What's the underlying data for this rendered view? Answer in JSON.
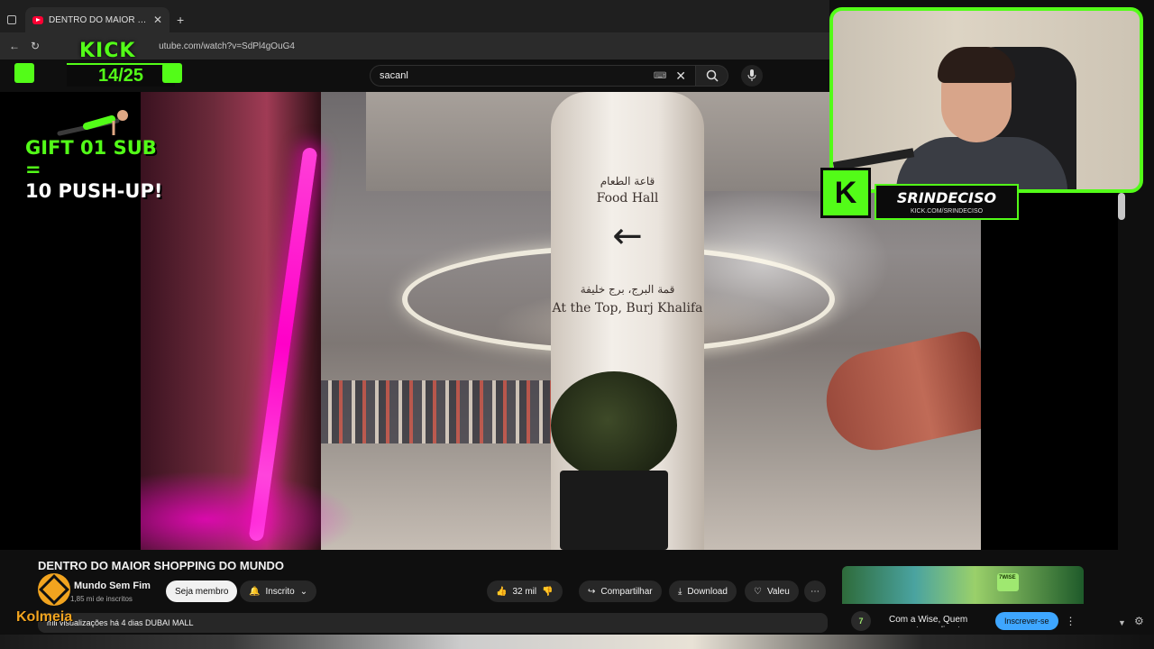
{
  "browser": {
    "tab_title": "DENTRO DO MAIOR SHOPPI",
    "url": "utube.com/watch?v=SdPl4gOuG4"
  },
  "search": {
    "query": "sacanl"
  },
  "overlay": {
    "kick_logo": "KICK",
    "counter": "14/25",
    "gift_line1": "GIFT 01 SUB =",
    "gift_line2": "10 PUSH-UP!",
    "streamer_name": "SRINDECISO",
    "streamer_url": "KICK.COM/SRINDECISO",
    "kolmeia": "Kolmeia"
  },
  "video_sign": {
    "ar1": "قاعة الطعام",
    "en1": "Food Hall",
    "arrow": "←",
    "ar2": "قمة البرج، برج خليفة",
    "en2": "At the Top, Burj Khalifa"
  },
  "video": {
    "title": "DENTRO DO MAIOR SHOPPING DO MUNDO",
    "channel_name": "Mundo Sem Fim",
    "channel_subs": "1,85 mi de inscritos",
    "join_label": "Seja membro",
    "subscribed_label": "Inscrito",
    "likes": "32 mil",
    "share_label": "Compartilhar",
    "download_label": "Download",
    "thanks_label": "Valeu",
    "description": "mil visualizações  há 4 dias  DUBAI MALL"
  },
  "ad": {
    "logo_text": "7WISE",
    "icon_text": "7",
    "text": "Com a Wise, Quem converte se diverte",
    "cta": "Inscrever-se"
  },
  "colors": {
    "kick_green": "#53fc18",
    "yt_red": "#ff0033",
    "cta_blue": "#3ea6ff"
  }
}
